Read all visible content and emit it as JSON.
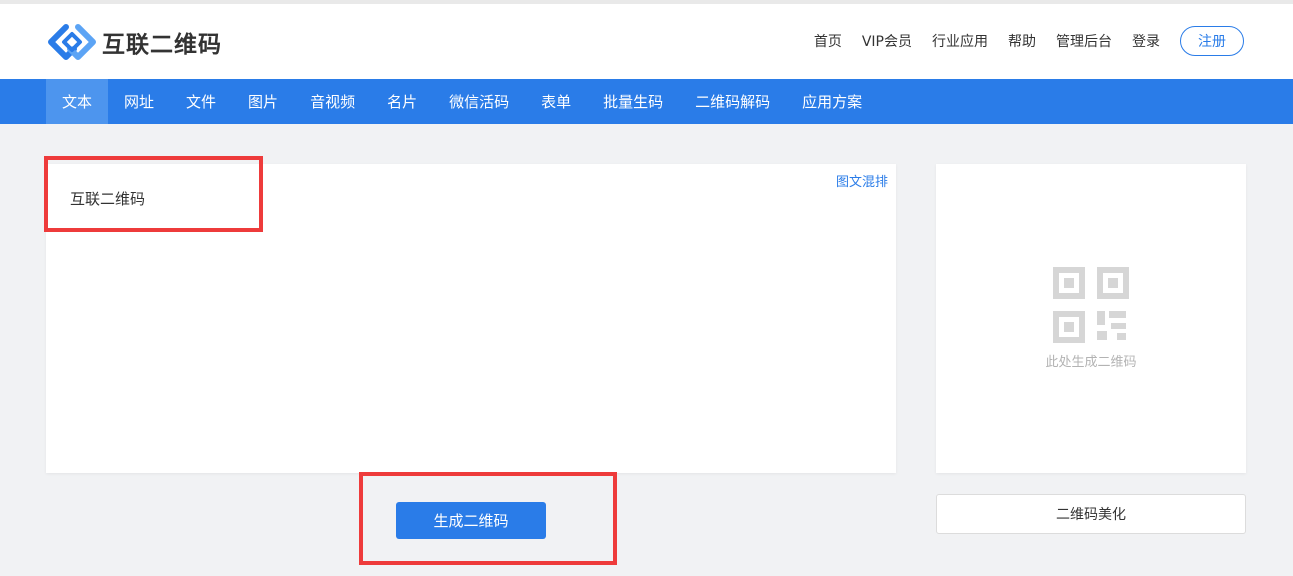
{
  "header": {
    "logo_text": "互联二维码",
    "links": [
      "首页",
      "VIP会员",
      "行业应用",
      "帮助",
      "管理后台",
      "登录"
    ],
    "register_label": "注册"
  },
  "nav": {
    "items": [
      "文本",
      "网址",
      "文件",
      "图片",
      "音视频",
      "名片",
      "微信活码",
      "表单",
      "批量生码",
      "二维码解码",
      "应用方案"
    ],
    "active": "文本"
  },
  "editor": {
    "content": "互联二维码",
    "mix_link": "图文混排"
  },
  "actions": {
    "generate_label": "生成二维码",
    "beautify_label": "二维码美化"
  },
  "qr_preview": {
    "caption": "此处生成二维码",
    "icon": "qr-code-icon"
  },
  "colors": {
    "accent": "#2a7ce8",
    "nav_active": "#4d95ee",
    "highlight_box": "#ee3b3b"
  }
}
